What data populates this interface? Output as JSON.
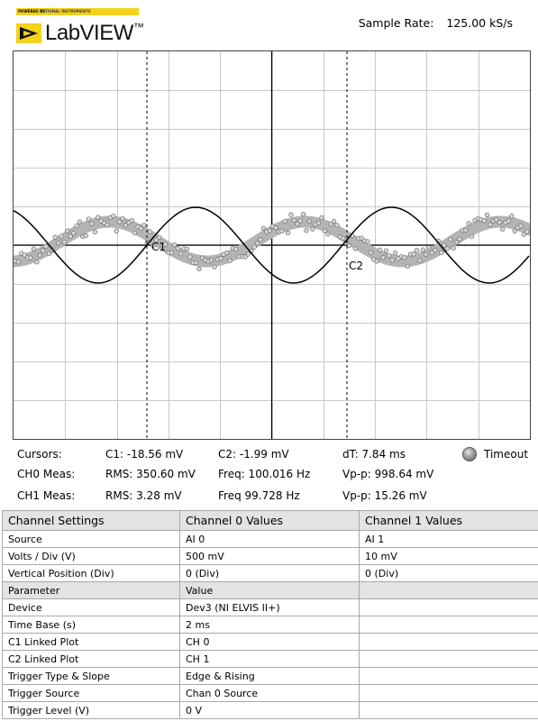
{
  "header": {
    "logo_powered_by": "POWERED BY",
    "logo_ni": "NATIONAL INSTRUMENTS",
    "logo_text": "LabVIEW",
    "trademark": "™",
    "sample_rate_label": "Sample Rate:",
    "sample_rate_value": "125.00 kS/s"
  },
  "scope": {
    "cursor_labels": [
      "C1",
      "C2"
    ]
  },
  "measurements": {
    "cursors_label": "Cursors:",
    "c1": "C1:  -18.56 mV",
    "c2": "C2:  -1.99 mV",
    "dt": "dT:  7.84 ms",
    "timeout_label": "Timeout",
    "ch0_label": "CH0 Meas:",
    "ch0_rms": "RMS:  350.60 mV",
    "ch0_freq": "Freq:  100.016 Hz",
    "ch0_vpp": "Vp-p:  998.64 mV",
    "ch1_label": "CH1 Meas:",
    "ch1_rms": "RMS:  3.28 mV",
    "ch1_freq": "Freq   99.728 Hz",
    "ch1_vpp": "Vp-p:  15.26 mV"
  },
  "table": {
    "headers": [
      "Channel Settings",
      "Channel 0 Values",
      "Channel 1 Values"
    ],
    "rows_a": [
      [
        "Source",
        "AI 0",
        "AI 1"
      ],
      [
        "Volts / Div (V)",
        "500 mV",
        "10 mV"
      ],
      [
        "Vertical Position (Div)",
        "0 (Div)",
        "0 (Div)"
      ]
    ],
    "subheader": [
      "Parameter",
      "Value",
      ""
    ],
    "rows_b": [
      [
        "Device",
        "Dev3 (NI ELVIS II+)",
        ""
      ],
      [
        "Time Base (s)",
        "2 ms",
        ""
      ],
      [
        "C1 Linked Plot",
        "CH 0",
        ""
      ],
      [
        "C2 Linked Plot",
        "CH 1",
        ""
      ],
      [
        "Trigger Type & Slope",
        "Edge & Rising",
        ""
      ],
      [
        "Trigger Source",
        "Chan 0 Source",
        ""
      ],
      [
        "Trigger Level (V)",
        "0 V",
        ""
      ]
    ]
  }
}
